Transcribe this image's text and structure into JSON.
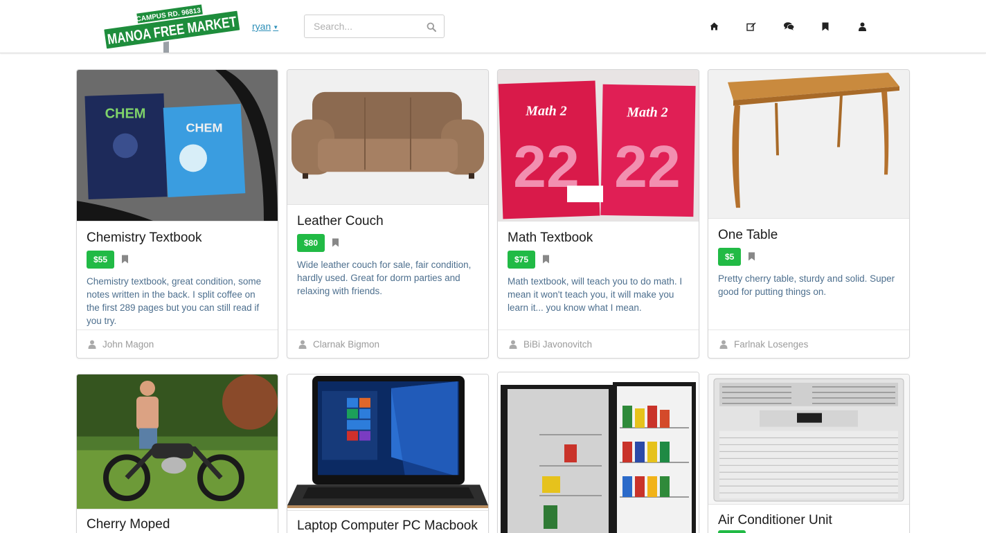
{
  "header": {
    "logo_top": "CAMPUS RD. 96813",
    "logo_main": "MANOA FREE MARKET",
    "username": "ryan",
    "search_placeholder": "Search...",
    "nav": [
      {
        "icon": "home-icon"
      },
      {
        "icon": "edit-icon"
      },
      {
        "icon": "comments-icon"
      },
      {
        "icon": "bookmark-icon"
      },
      {
        "icon": "user-icon"
      }
    ]
  },
  "listings": [
    {
      "title": "Chemistry Textbook",
      "price": "$55",
      "description": "Chemistry textbook, great condition, some notes written in the back. I split coffee on the first 289 pages but you can still read if you try.",
      "seller": "John Magon",
      "image": "chemistry-books-image"
    },
    {
      "title": "Leather Couch",
      "price": "$80",
      "description": "Wide leather couch for sale, fair condition, hardly used. Great for dorm parties and relaxing with friends.",
      "seller": "Clarnak Bigmon",
      "image": "couch-image"
    },
    {
      "title": "Math Textbook",
      "price": "$75",
      "description": "Math textbook, will teach you to do math. I mean it won't teach you, it will make you learn it... you know what I mean.",
      "seller": "BiBi Javonovitch",
      "image": "math-books-image"
    },
    {
      "title": "One Table",
      "price": "$5",
      "description": "Pretty cherry table, sturdy and solid. Super good for putting things on.",
      "seller": "Farlnak Losenges",
      "image": "table-image"
    },
    {
      "title": "Cherry Moped",
      "image": "moped-image"
    },
    {
      "title": "Laptop Computer PC Macbook",
      "image": "laptop-image"
    },
    {
      "title": "",
      "image": "fridge-image"
    },
    {
      "title": "Air Conditioner Unit",
      "image": "air-conditioner-image"
    }
  ],
  "colors": {
    "price": "#21ba45",
    "description": "#4d6f8e",
    "link": "#2d8fb8"
  }
}
